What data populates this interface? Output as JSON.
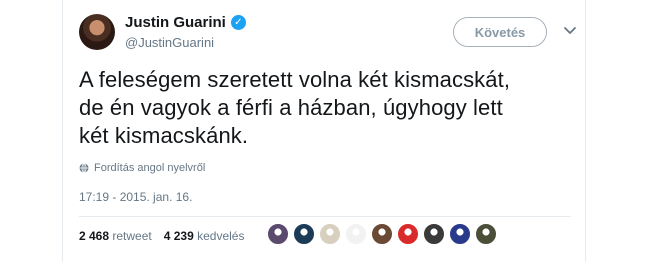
{
  "tweet": {
    "author": {
      "display_name": "Justin Guarini",
      "handle": "@JustinGuarini",
      "verified_icon": "verified-badge-icon"
    },
    "follow_label": "Követés",
    "text_lines": [
      "A feleségem szeretett volna két kismacskát,",
      "de én vagyok a férfi a házban, úgyhogy lett",
      "két kismacskánk."
    ],
    "translate_label": "Fordítás angol nyelvről",
    "timestamp": "17:19 - 2015. jan. 16.",
    "stats": {
      "retweets_count": "2 468",
      "retweets_label": "retweet",
      "likes_count": "4 239",
      "likes_label": "kedvelés"
    },
    "likers": [
      {
        "name": "liker-avatar-1",
        "color": "#5a4a6e"
      },
      {
        "name": "liker-avatar-2",
        "color": "#1c3b57"
      },
      {
        "name": "liker-avatar-3",
        "color": "#d7d0bf"
      },
      {
        "name": "liker-avatar-4",
        "color": "#f2f2f2"
      },
      {
        "name": "liker-avatar-5",
        "color": "#6b4a35"
      },
      {
        "name": "liker-avatar-6",
        "color": "#d92b2b"
      },
      {
        "name": "liker-avatar-7",
        "color": "#3a3a3a"
      },
      {
        "name": "liker-avatar-8",
        "color": "#2a3a8a"
      },
      {
        "name": "liker-avatar-9",
        "color": "#4b4f3a"
      }
    ]
  },
  "colors": {
    "accent": "#1da1f2",
    "text": "#14171a",
    "muted": "#657786",
    "border": "#e6ecf0"
  }
}
